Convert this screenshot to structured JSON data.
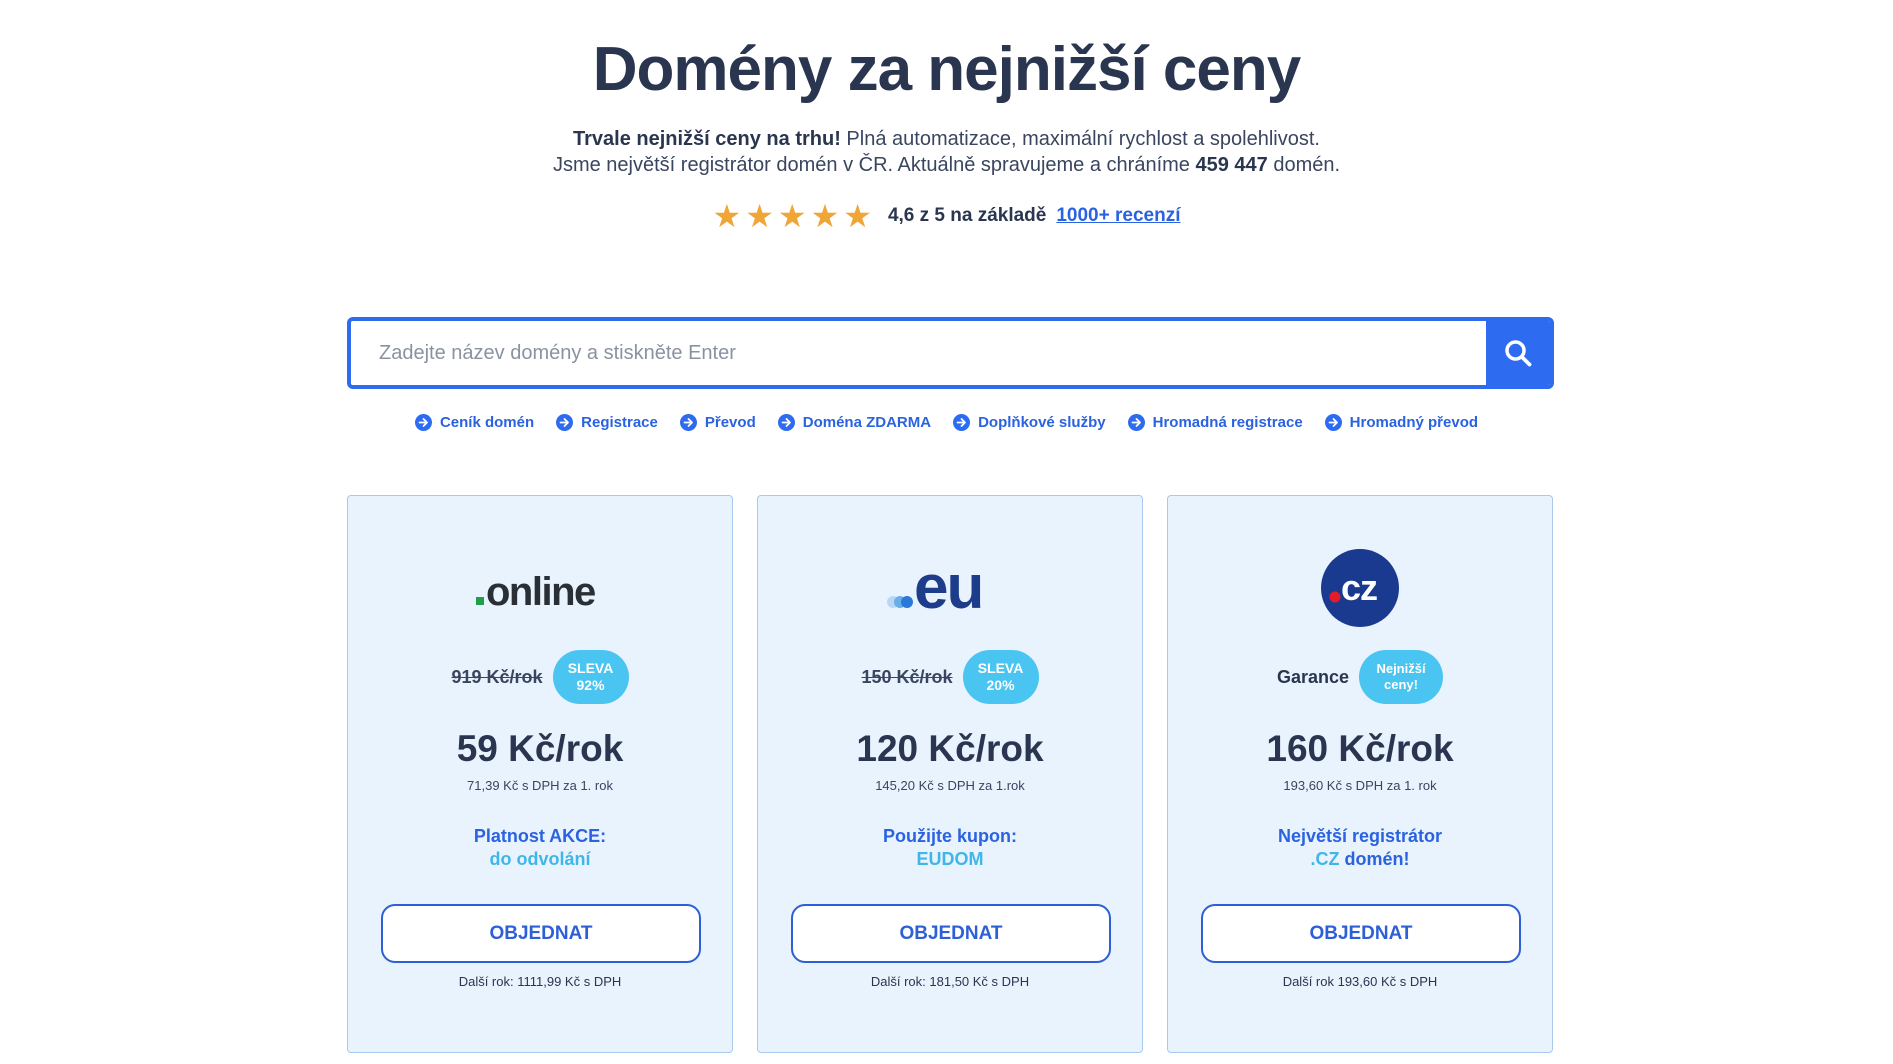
{
  "hero": {
    "title": "Domény za nejnižší ceny",
    "intro_line1_bold": "Trvale nejnižší ceny na trhu!",
    "intro_line1_rest": " Plná automatizace, maximální rychlost a spolehlivost.",
    "intro_line2_start": "Jsme největší registrátor domén v ČR. Aktuálně spravujeme a chráníme ",
    "intro_line2_count": "459 447",
    "intro_line2_end": " domén.",
    "rating_stars": 5,
    "rating_text": "4,6 z 5 na základě",
    "rating_link": "1000+ recenzí"
  },
  "search": {
    "placeholder": "Zadejte název domény a stiskněte Enter",
    "button_icon": "search-icon"
  },
  "quicklinks": [
    {
      "label": "Ceník domén",
      "icon": "arrow-right-circle-icon"
    },
    {
      "label": "Registrace",
      "icon": "arrow-right-circle-icon"
    },
    {
      "label": "Převod",
      "icon": "arrow-right-circle-icon"
    },
    {
      "label": "Doména ZDARMA",
      "icon": "arrow-right-circle-icon"
    },
    {
      "label": "Doplňkové služby",
      "icon": "arrow-right-circle-icon"
    },
    {
      "label": "Hromadná registrace",
      "icon": "arrow-right-circle-icon"
    },
    {
      "label": "Hromadný převod",
      "icon": "arrow-right-circle-icon"
    }
  ],
  "cards": [
    {
      "logo": "online",
      "old_price": "919 Kč/rok",
      "badge_line1": "SLEVA",
      "badge_line2": "92%",
      "price": "59 Kč/rok",
      "vat": "71,39 Kč s DPH za 1. rok",
      "promo_line1": "Platnost AKCE:",
      "promo_line2": "do odvolání",
      "button": "OBJEDNAT",
      "next_year": "Další rok: 1111,99 Kč s DPH"
    },
    {
      "logo": "eu",
      "old_price": "150 Kč/rok",
      "badge_line1": "SLEVA",
      "badge_line2": "20%",
      "price": "120 Kč/rok",
      "vat": "145,20 Kč s DPH za 1.rok",
      "promo_line1": "Použijte kupon:",
      "promo_line2": "EUDOM",
      "button": "OBJEDNAT",
      "next_year": "Další rok: 181,50 Kč s DPH"
    },
    {
      "logo": ".cz",
      "garance": "Garance",
      "badge_line1": "Nejnižší",
      "badge_line2": "ceny!",
      "price": "160 Kč/rok",
      "vat": "193,60 Kč s DPH za 1. rok",
      "promo_line1": "Největší registrátor",
      "promo_line2_hl": ".CZ",
      "promo_line2_rest": " domén!",
      "button": "OBJEDNAT",
      "next_year": "Další rok 193,60 Kč s DPH"
    }
  ],
  "colors": {
    "accent": "#2d6cf0",
    "badge": "#4ac4f0",
    "card_bg": "#e9f3fd",
    "star": "#f0a537",
    "text_dark": "#2a3550",
    "cz_logo": "#1a3a8f",
    "cz_dot": "#e11d2a",
    "online_dot": "#1ea04a"
  }
}
